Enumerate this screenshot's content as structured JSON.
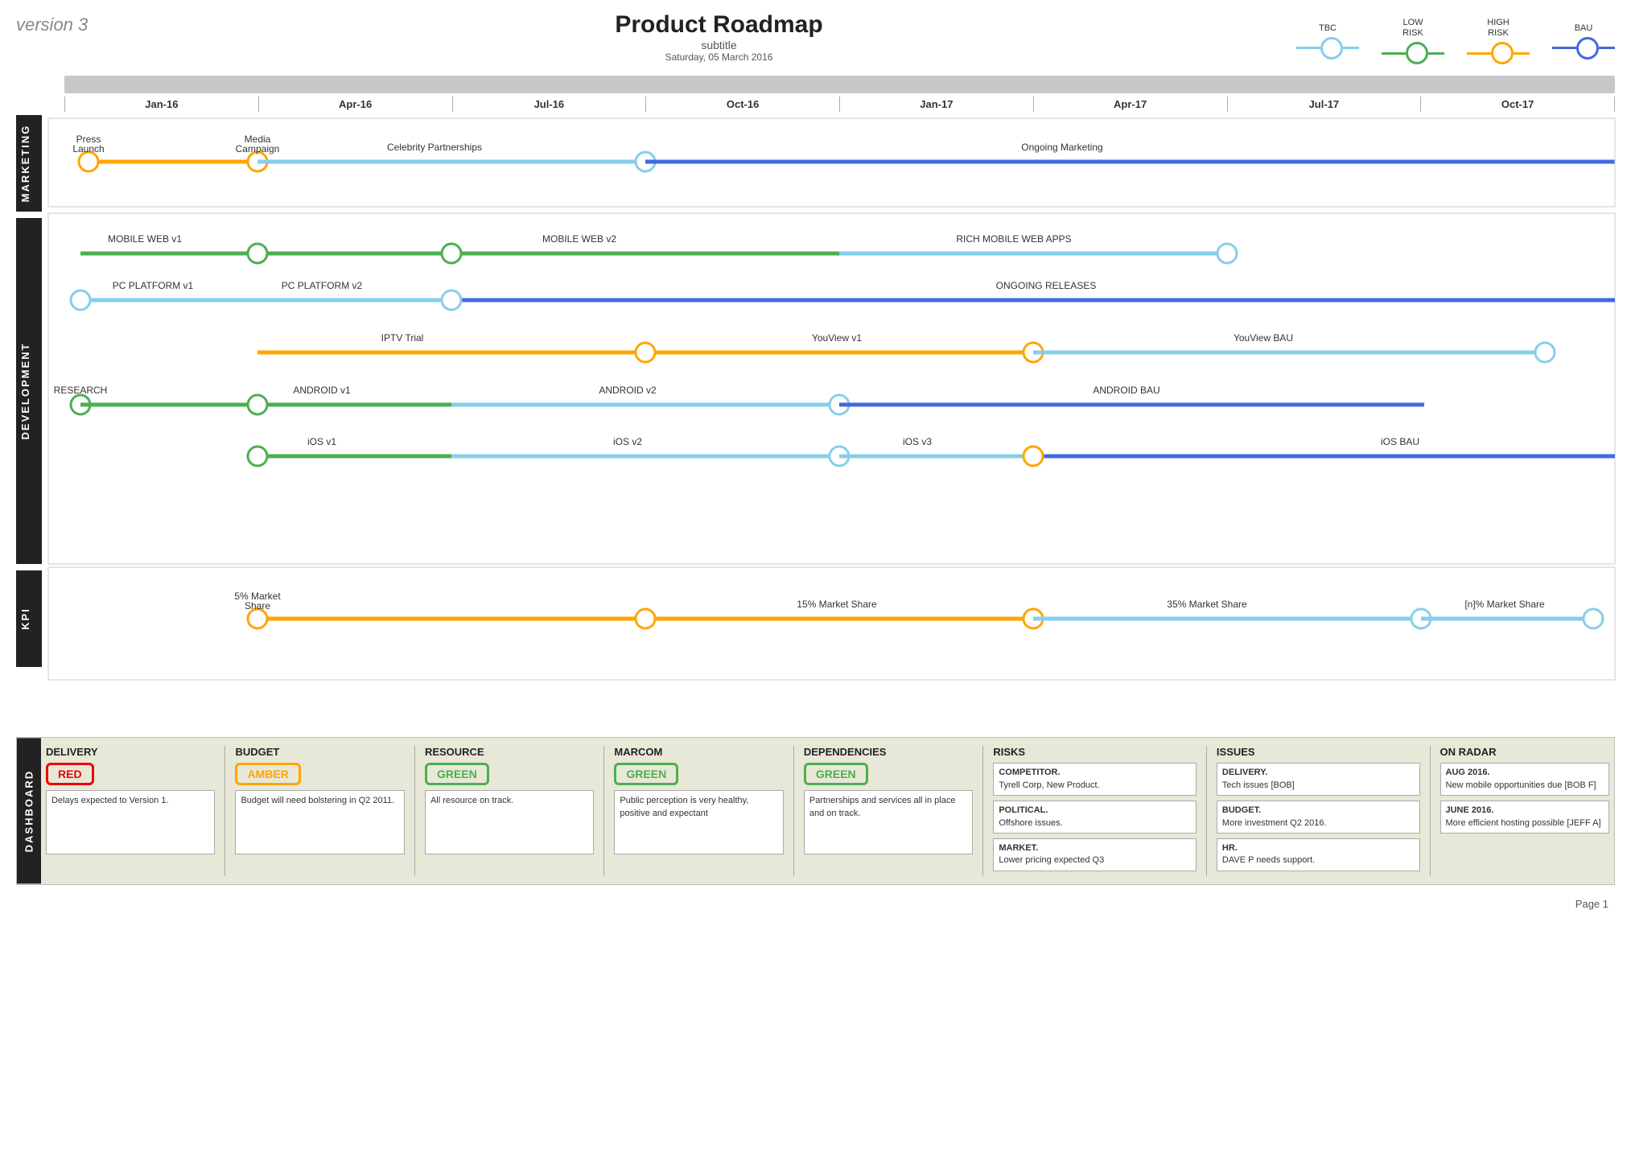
{
  "header": {
    "version": "version 3",
    "title": "Product Roadmap",
    "subtitle": "subtitle",
    "date": "Saturday, 05 March 2016"
  },
  "legend": {
    "items": [
      {
        "id": "tbc",
        "label": "TBC",
        "color": "#87CEEB"
      },
      {
        "id": "low-risk",
        "label": "LOW\nRISK",
        "color": "#4CAF50"
      },
      {
        "id": "high-risk",
        "label": "HIGH\nRISK",
        "color": "#FFA500"
      },
      {
        "id": "bau",
        "label": "BAU",
        "color": "#4169E1"
      }
    ]
  },
  "timeline": {
    "months": [
      "Jan-16",
      "Apr-16",
      "Jul-16",
      "Oct-16",
      "Jan-17",
      "Apr-17",
      "Jul-17",
      "Oct-17"
    ]
  },
  "sections": {
    "marketing": {
      "label": "MARKETING",
      "rows": [
        {
          "label": "Press Launch",
          "label2": "Media Campaign",
          "label3": "Celebrity Partnerships",
          "label4": "Ongoing Marketing"
        }
      ]
    },
    "development": {
      "label": "DEVELOPMENT",
      "rows": [
        {
          "name": "mobile-web",
          "label1": "MOBILE WEB v1",
          "label2": "MOBILE WEB v2",
          "label3": "RICH MOBILE WEB APPS"
        },
        {
          "name": "pc-platform",
          "label1": "PC PLATFORM v1",
          "label2": "PC PLATFORM v2",
          "label3": "ONGOING RELEASES"
        },
        {
          "name": "iptv",
          "label1": "IPTV Trial",
          "label2": "YouView v1",
          "label3": "YouView BAU"
        },
        {
          "name": "android",
          "label0": "RESEARCH",
          "label1": "ANDROID v1",
          "label2": "ANDROID v2",
          "label3": "ANDROID BAU"
        },
        {
          "name": "ios",
          "label1": "iOS v1",
          "label2": "iOS v2",
          "label3": "iOS v3",
          "label4": "iOS BAU"
        }
      ]
    },
    "kpi": {
      "label": "KPI",
      "rows": [
        {
          "name": "kpi-row",
          "label1": "5% Market\nShare",
          "label2": "15% Market Share",
          "label3": "35% Market Share",
          "label4": "[n]% Market Share"
        }
      ]
    }
  },
  "dashboard": {
    "label": "DASHBOARD",
    "cards": {
      "delivery": {
        "title": "DELIVERY",
        "badge": "RED",
        "badge_type": "red",
        "text": "Delays expected to Version 1."
      },
      "budget": {
        "title": "BUDGET",
        "badge": "AMBER",
        "badge_type": "amber",
        "text": "Budget will need bolstering in Q2 2011."
      },
      "resource": {
        "title": "RESOURCE",
        "badge": "GREEN",
        "badge_type": "green",
        "text": "All resource on track."
      },
      "marcom": {
        "title": "MARCOM",
        "badge": "GREEN",
        "badge_type": "green",
        "text": "Public perception is very healthy, positive and expectant"
      },
      "dependencies": {
        "title": "DEPENDENCIES",
        "badge": "GREEN",
        "badge_type": "green",
        "text": "Partnerships and services all in place and on track."
      }
    },
    "risks": {
      "title": "RISKS",
      "items": [
        {
          "title": "COMPETITOR.",
          "text": "Tyrell Corp, New Product."
        },
        {
          "title": "POLITICAL.",
          "text": "Offshore issues."
        },
        {
          "title": "MARKET.",
          "text": "Lower pricing expected Q3"
        }
      ]
    },
    "issues": {
      "title": "ISSUES",
      "items": [
        {
          "title": "DELIVERY.",
          "text": "Tech issues [BOB]"
        },
        {
          "title": "BUDGET.",
          "text": "More investment Q2 2016."
        },
        {
          "title": "HR.",
          "text": "DAVE P needs support."
        }
      ]
    },
    "on_radar": {
      "title": "ON RADAR",
      "items": [
        {
          "title": "AUG 2016.",
          "text": "New mobile opportunities due [BOB F]"
        },
        {
          "title": "JUNE 2016.",
          "text": "More efficient hosting possible [JEFF A]"
        }
      ]
    }
  },
  "page": "Page 1"
}
